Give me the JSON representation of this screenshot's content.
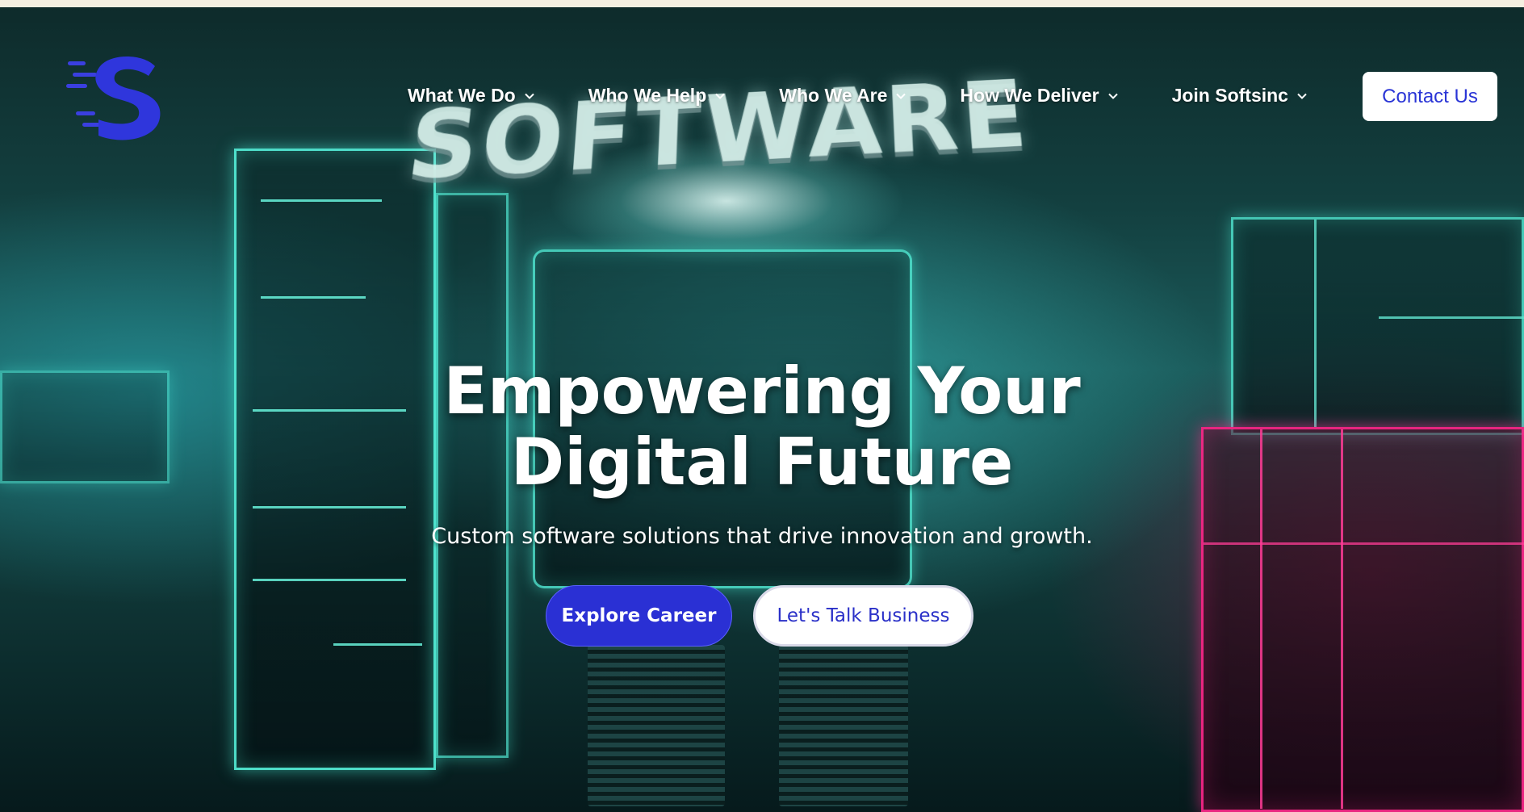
{
  "brand": {
    "logo_icon": "softsinc-s-logo",
    "accent": "#2a30d4"
  },
  "nav": {
    "items": [
      {
        "label": "What We Do"
      },
      {
        "label": "Who We Help"
      },
      {
        "label": "Who We Are"
      },
      {
        "label": "How We Deliver"
      },
      {
        "label": "Join Softsinc"
      }
    ],
    "contact_label": "Contact Us"
  },
  "hero": {
    "background_text": "SOFTWARE",
    "headline_line1": "Empowering Your",
    "headline_line2": "Digital Future",
    "subheadline": "Custom software solutions that drive innovation and growth.",
    "primary_cta": "Explore Career",
    "secondary_cta": "Let's Talk Business"
  }
}
